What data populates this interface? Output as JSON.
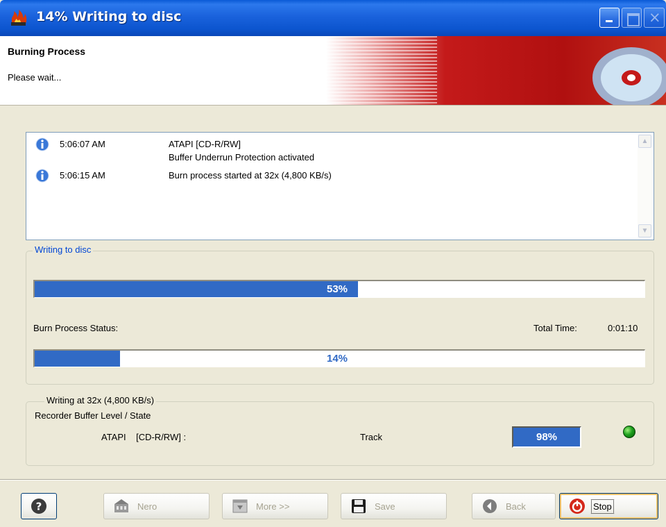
{
  "window": {
    "title": "14% Writing to disc",
    "icon": "nero-flame-icon"
  },
  "header": {
    "title": "Burning Process",
    "subtitle": "Please wait..."
  },
  "log": {
    "entries": [
      {
        "icon": "info-icon",
        "time": "5:06:07 AM",
        "message": "ATAPI    [CD-R/RW]",
        "detail": "Buffer Underrun Protection activated"
      },
      {
        "icon": "info-icon",
        "time": "5:06:15 AM",
        "message": "Burn process started at 32x (4,800 KB/s)",
        "detail": ""
      }
    ]
  },
  "writing": {
    "legend": "Writing to disc",
    "track_progress": 0.53,
    "track_progress_text": "53%",
    "status_label": "Burn Process Status:",
    "total_time_label": "Total Time:",
    "total_time_value": "0:01:10",
    "overall_progress": 0.14,
    "overall_progress_text": "14%"
  },
  "recorder": {
    "legend": "Writing at 32x (4,800 KB/s)",
    "buffer_label": "Recorder Buffer Level / State",
    "device": "ATAPI    [CD-R/RW] :",
    "state": "Track",
    "buffer_level_text": "98%",
    "led_color": "#1ea01e"
  },
  "buttons": {
    "help": "",
    "nero": "Nero",
    "more": "More >>",
    "save": "Save",
    "back": "Back",
    "stop": "Stop"
  },
  "colors": {
    "accent": "#316ac5",
    "titlebar": "#0a5ad6",
    "banner": "#c41a1a"
  }
}
